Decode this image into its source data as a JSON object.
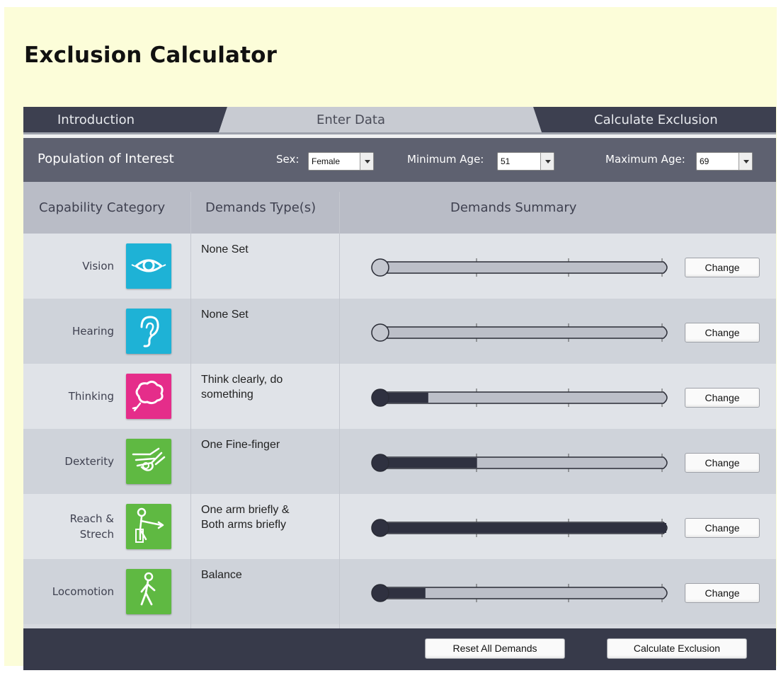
{
  "page": {
    "title": "Exclusion Calculator"
  },
  "tabs": [
    {
      "label": "Introduction",
      "active": false
    },
    {
      "label": "Enter Data",
      "active": true
    },
    {
      "label": "Calculate Exclusion",
      "active": false
    }
  ],
  "population": {
    "title": "Population of Interest",
    "sex_label": "Sex:",
    "sex_value": "Female",
    "min_age_label": "Minimum Age:",
    "min_age_value": "51",
    "max_age_label": "Maximum Age:",
    "max_age_value": "69"
  },
  "table": {
    "headers": [
      "Capability Category",
      "Demands Type(s)",
      "Demands Summary"
    ],
    "change_label": "Change",
    "rows": [
      {
        "category": "Vision",
        "icon": "eye-icon",
        "icon_color": "#1eb2d6",
        "demands": "None Set",
        "level": 0,
        "set": false
      },
      {
        "category": "Hearing",
        "icon": "ear-icon",
        "icon_color": "#1eb2d6",
        "demands": "None Set",
        "level": 0,
        "set": false
      },
      {
        "category": "Thinking",
        "icon": "thought-bubble-icon",
        "icon_color": "#e52d8a",
        "demands": "Think clearly, do\nsomething",
        "level": 0.17,
        "set": true
      },
      {
        "category": "Dexterity",
        "icon": "hand-icon",
        "icon_color": "#5fb942",
        "demands": "One Fine-finger",
        "level": 0.34,
        "set": true
      },
      {
        "category": "Reach &\nStrech",
        "icon": "reaching-person-icon",
        "icon_color": "#5fb942",
        "demands": "One arm briefly &\nBoth arms briefly",
        "level": 1.0,
        "set": true
      },
      {
        "category": "Locomotion",
        "icon": "walking-person-icon",
        "icon_color": "#5fb942",
        "demands": "Balance",
        "level": 0.16,
        "set": true
      }
    ]
  },
  "footer": {
    "reset_label": "Reset All Demands",
    "calculate_label": "Calculate Exclusion"
  }
}
